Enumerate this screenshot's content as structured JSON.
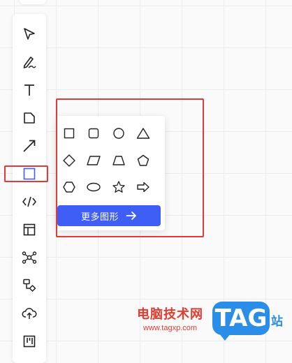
{
  "toolbar": {
    "tools": [
      {
        "icon": "cursor-icon"
      },
      {
        "icon": "pen-icon"
      },
      {
        "icon": "text-icon"
      },
      {
        "icon": "sticky-note-icon"
      },
      {
        "icon": "arrow-connector-icon"
      },
      {
        "icon": "rectangle-icon",
        "selected": true
      },
      {
        "icon": "code-icon"
      },
      {
        "icon": "layout-template-icon"
      },
      {
        "icon": "mindmap-icon"
      },
      {
        "icon": "flowchart-icon"
      },
      {
        "icon": "upload-cloud-icon"
      },
      {
        "icon": "kanban-icon"
      }
    ]
  },
  "shape_panel": {
    "shapes": [
      "square",
      "rounded-square",
      "circle",
      "triangle",
      "diamond",
      "parallelogram",
      "trapezoid",
      "pentagon",
      "hexagon",
      "ellipse",
      "star",
      "arrow-right"
    ],
    "more_button": {
      "label": "更多图形",
      "icon": "arrow-right-icon"
    }
  },
  "colors": {
    "accent": "#3f5ef5",
    "annotation": "#e03b3b",
    "icon": "#222222"
  },
  "watermark": {
    "site_name": "电脑技术网",
    "url": "www.tagxp.com",
    "logo_text": "TAG",
    "logo_suffix": "站"
  }
}
